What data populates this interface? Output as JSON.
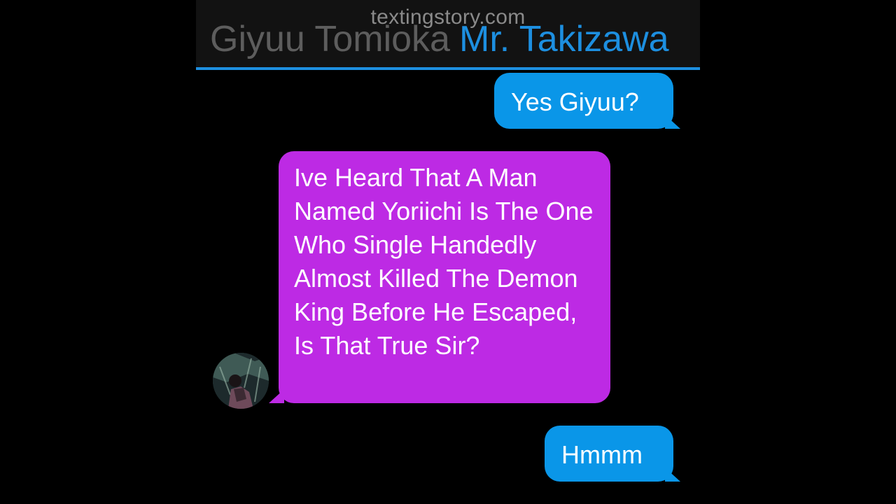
{
  "header": {
    "watermark": "textingstory.com",
    "contact_left": "Giyuu Tomioka",
    "contact_right": "Mr. Takizawa",
    "accent_color": "#1d8fe0"
  },
  "messages": [
    {
      "side": "right",
      "text": "Yes Giyuu?"
    },
    {
      "side": "left",
      "text": "Ive Heard That A Man Named Yoriichi Is The One Who Single Handedly Almost Killed The Demon King Before He Escaped, Is That True Sir?"
    },
    {
      "side": "right",
      "text": "Hmmm"
    }
  ],
  "colors": {
    "right_bubble": "#0a96e8",
    "left_bubble": "#bd2ae4",
    "background": "#000000"
  },
  "avatar": {
    "icon": "profile-photo-icon"
  }
}
